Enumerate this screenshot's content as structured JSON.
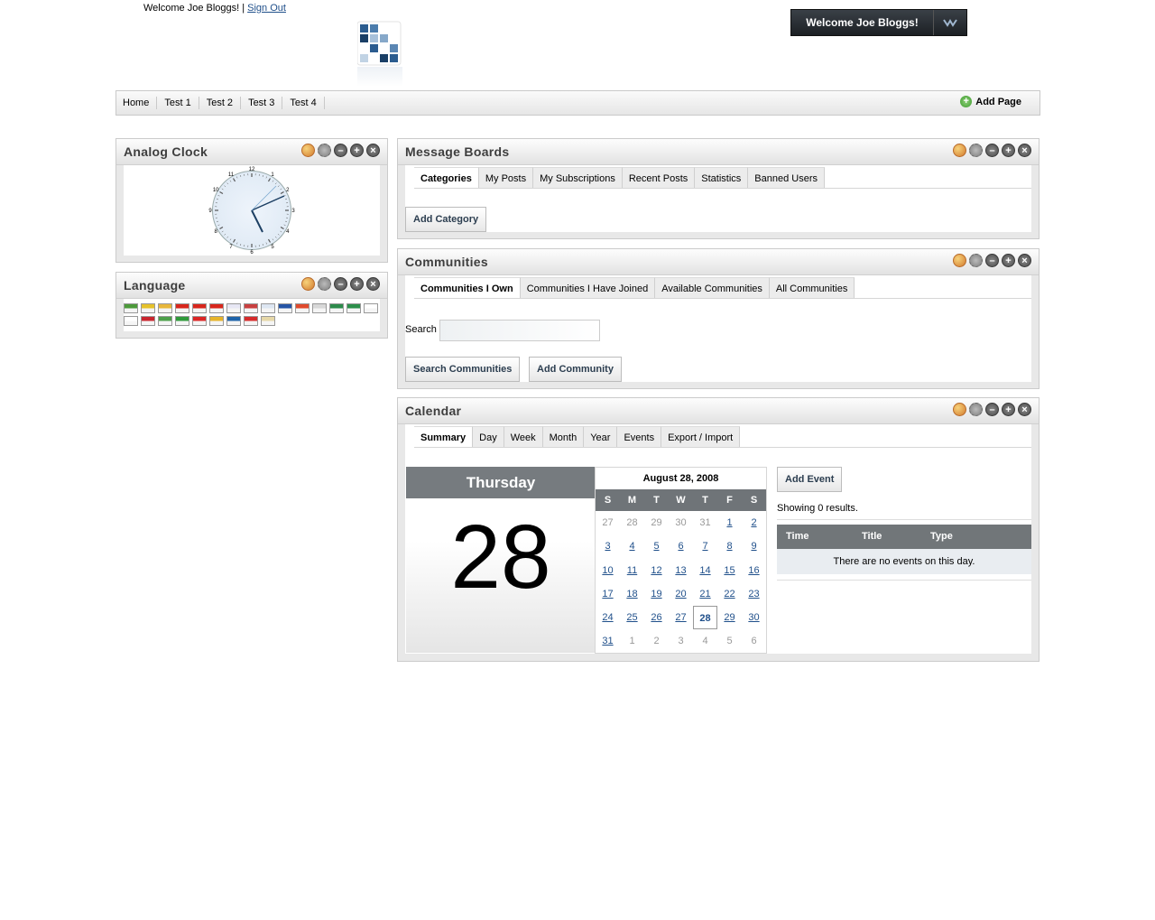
{
  "header": {
    "welcome": "Welcome Joe Bloggs! | ",
    "sign_out": "Sign Out"
  },
  "dock": {
    "label": "Welcome Joe Bloggs!"
  },
  "nav": {
    "items": [
      "Home",
      "Test 1",
      "Test 2",
      "Test 3",
      "Test 4"
    ],
    "add_page": "Add Page"
  },
  "clock_portlet": {
    "title": "Analog Clock",
    "numbers": [
      "12",
      "1",
      "2",
      "3",
      "4",
      "5",
      "6",
      "7",
      "8",
      "9",
      "10",
      "11"
    ]
  },
  "language_portlet": {
    "title": "Language",
    "flag_colors": [
      "#4c9a3a",
      "#e6c22b",
      "#e8b73c",
      "#d8261c",
      "#d8261c",
      "#d8261c",
      "#e7e7f4",
      "#c94040",
      "#dde6f2",
      "#2554a5",
      "#e04a2d",
      "#d8d8d8",
      "#2c8a4a",
      "#2c8f4a",
      "#ffffff",
      "#ffffff",
      "#c9252e",
      "#4da04a",
      "#2f9a3a",
      "#dc2626",
      "#e6b42a",
      "#1e63a9",
      "#d62b2b",
      "#e6d8a8"
    ]
  },
  "message_boards": {
    "title": "Message Boards",
    "tabs": [
      "Categories",
      "My Posts",
      "My Subscriptions",
      "Recent Posts",
      "Statistics",
      "Banned Users"
    ],
    "add_category": "Add Category"
  },
  "communities": {
    "title": "Communities",
    "tabs": [
      "Communities I Own",
      "Communities I Have Joined",
      "Available Communities",
      "All Communities"
    ],
    "search_label": "Search",
    "search_value": "",
    "search_button": "Search Communities",
    "add_button": "Add Community"
  },
  "calendar": {
    "title": "Calendar",
    "tabs": [
      "Summary",
      "Day",
      "Week",
      "Month",
      "Year",
      "Events",
      "Export / Import"
    ],
    "day_name": "Thursday",
    "day_number": "28",
    "month_title": "August 28, 2008",
    "dow": [
      "S",
      "M",
      "T",
      "W",
      "T",
      "F",
      "S"
    ],
    "days": [
      "27",
      "28",
      "29",
      "30",
      "31",
      "1",
      "2",
      "3",
      "4",
      "5",
      "6",
      "7",
      "8",
      "9",
      "10",
      "11",
      "12",
      "13",
      "14",
      "15",
      "16",
      "17",
      "18",
      "19",
      "20",
      "21",
      "22",
      "23",
      "24",
      "25",
      "26",
      "27",
      "28",
      "29",
      "30",
      "31",
      "1",
      "2",
      "3",
      "4",
      "5",
      "6"
    ],
    "add_event": "Add Event",
    "showing": "Showing 0 results.",
    "columns": [
      "Time",
      "Title",
      "Type"
    ],
    "empty": "There are no events on this day."
  }
}
